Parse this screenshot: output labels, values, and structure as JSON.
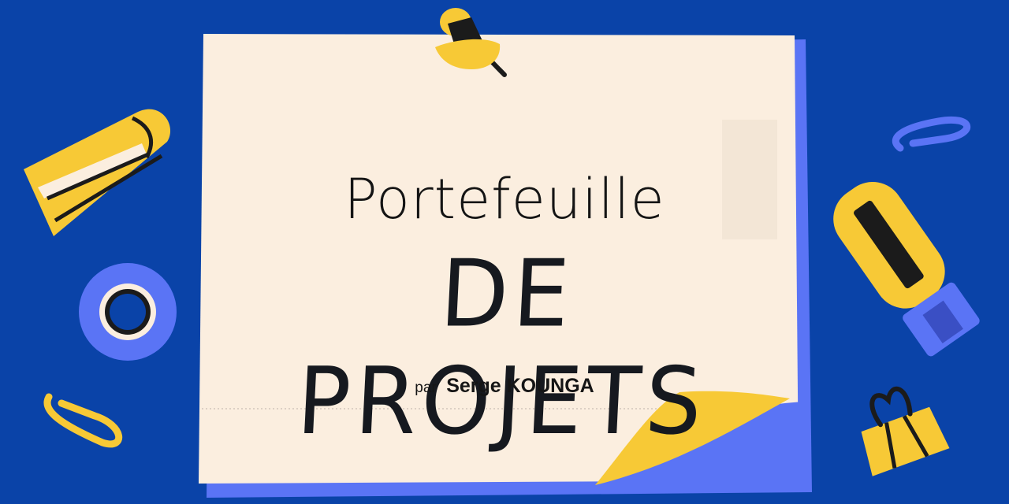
{
  "title": {
    "line1": "Portefeuille",
    "line2": "DE PROJETS"
  },
  "byline": {
    "prefix": "par",
    "author": "Serge KOUNGA"
  },
  "colors": {
    "background": "#0a43a8",
    "paper": "#fbeedf",
    "yellow": "#f7c936",
    "periwinkle": "#5a74f5",
    "ink": "#16191f"
  },
  "icons": [
    "stapler-icon",
    "tape-roll-icon",
    "paper-clip-icon",
    "pushpin-icon",
    "highlighter-icon",
    "binder-clip-icon"
  ]
}
